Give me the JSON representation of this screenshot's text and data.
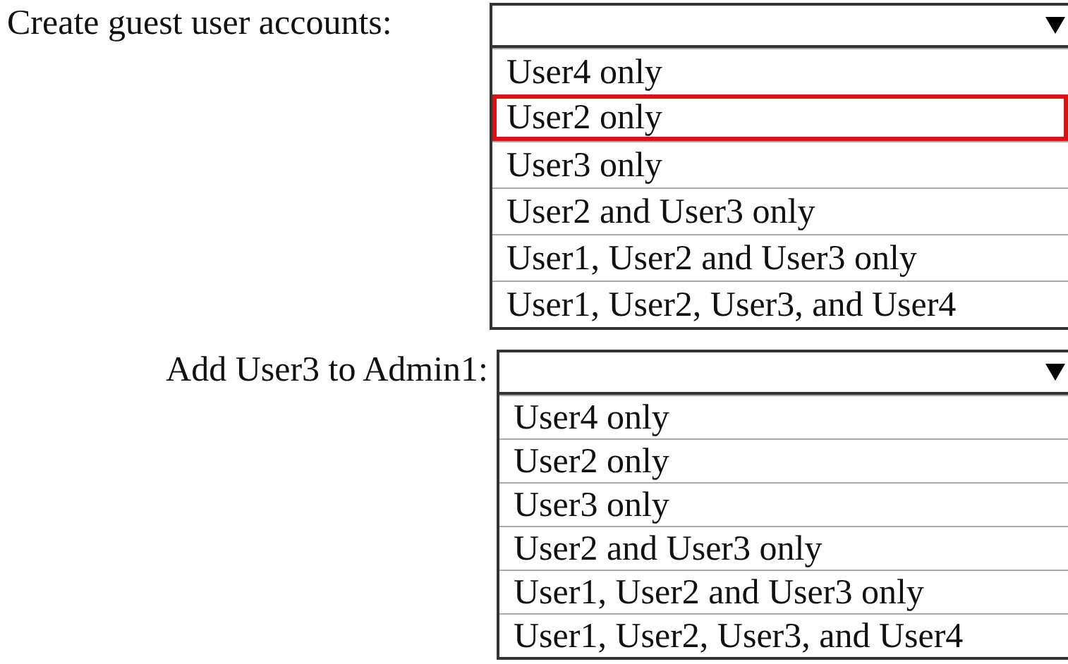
{
  "questions": [
    {
      "label": "Create guest user accounts:",
      "options": [
        {
          "text": "User4 only",
          "selected": false
        },
        {
          "text": "User2 only",
          "selected": true
        },
        {
          "text": "User3 only",
          "selected": false
        },
        {
          "text": "User2 and User3 only",
          "selected": false
        },
        {
          "text": "User1, User2 and User3 only",
          "selected": false
        },
        {
          "text": "User1, User2, User3, and User4",
          "selected": false
        }
      ]
    },
    {
      "label": "Add User3 to Admin1:",
      "options": [
        {
          "text": "User4 only",
          "selected": false
        },
        {
          "text": "User2 only",
          "selected": false
        },
        {
          "text": "User3 only",
          "selected": false
        },
        {
          "text": "User2 and User3 only",
          "selected": false
        },
        {
          "text": "User1, User2 and User3 only",
          "selected": false
        },
        {
          "text": "User1, User2, User3, and User4",
          "selected": false
        }
      ]
    }
  ]
}
